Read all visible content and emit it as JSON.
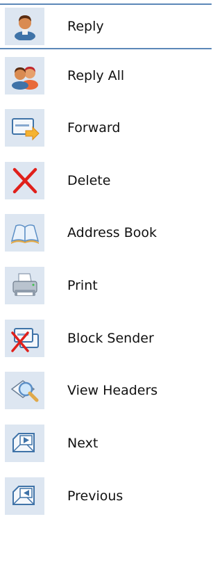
{
  "menu": {
    "items": [
      {
        "label": "Reply",
        "icon": "person-icon",
        "selected": true
      },
      {
        "label": "Reply All",
        "icon": "two-people-icon"
      },
      {
        "label": "Forward",
        "icon": "envelope-forward-icon"
      },
      {
        "label": "Delete",
        "icon": "delete-x-icon"
      },
      {
        "label": "Address Book",
        "icon": "open-book-icon"
      },
      {
        "label": "Print",
        "icon": "printer-icon"
      },
      {
        "label": "Block Sender",
        "icon": "block-sender-icon"
      },
      {
        "label": "View Headers",
        "icon": "magnifier-envelope-icon"
      },
      {
        "label": "Next",
        "icon": "next-envelope-icon"
      },
      {
        "label": "Previous",
        "icon": "previous-envelope-icon"
      }
    ]
  },
  "colors": {
    "selection_border": "#5b87b8",
    "icon_tile": "#dde6f1",
    "delete_red": "#e0201b"
  }
}
